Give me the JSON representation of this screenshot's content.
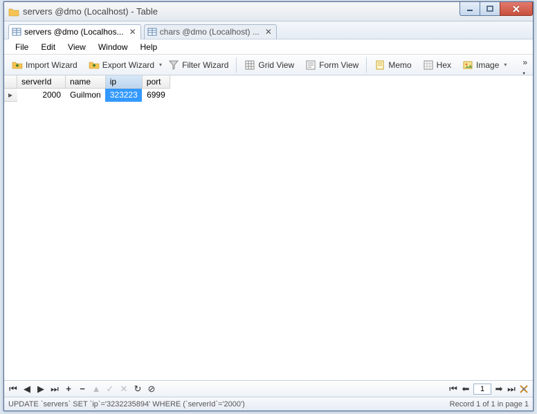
{
  "window": {
    "title": "servers @dmo (Localhost) - Table"
  },
  "tabs": [
    {
      "label": "servers @dmo (Localhos...",
      "active": true
    },
    {
      "label": "chars @dmo (Localhost) ...",
      "active": false
    }
  ],
  "menu": {
    "file": "File",
    "edit": "Edit",
    "view": "View",
    "window": "Window",
    "help": "Help"
  },
  "toolbar": {
    "import_wizard": "Import Wizard",
    "export_wizard": "Export Wizard",
    "filter_wizard": "Filter Wizard",
    "grid_view": "Grid View",
    "form_view": "Form View",
    "memo": "Memo",
    "hex": "Hex",
    "image": "Image"
  },
  "table": {
    "columns": [
      "serverId",
      "name",
      "ip",
      "port"
    ],
    "sorted_column_index": 2,
    "rows": [
      {
        "serverId": "2000",
        "name": "Guilmon",
        "ip": "323223",
        "port": "6999",
        "selected_col": "ip"
      }
    ]
  },
  "nav": {
    "page_value": "1"
  },
  "status": {
    "query": "UPDATE `servers` SET `ip`='3232235894' WHERE (`serverId`='2000')",
    "record": "Record 1 of 1 in page 1"
  }
}
